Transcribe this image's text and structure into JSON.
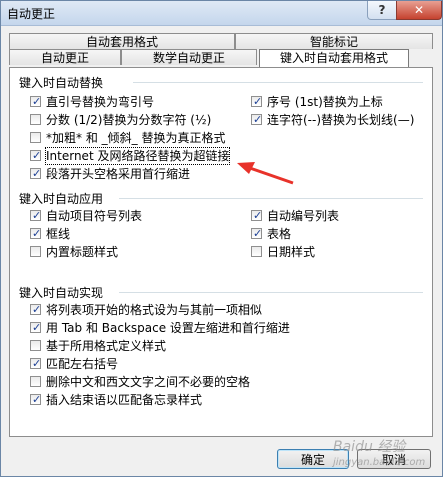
{
  "window": {
    "title": "自动更正",
    "help_label": "?",
    "close_label": "✕"
  },
  "tabs_back": [
    "自动套用格式",
    "智能标记"
  ],
  "tabs_front": [
    "自动更正",
    "数学自动更正",
    "键入时自动套用格式"
  ],
  "groups": {
    "replace": {
      "title": "键入时自动替换",
      "left": [
        {
          "label": "直引号替换为弯引号",
          "checked": true
        },
        {
          "label": "分数 (1/2)替换为分数字符 (½)",
          "checked": false
        },
        {
          "label": "*加粗* 和 _倾斜_ 替换为真正格式",
          "checked": false
        },
        {
          "label": "Internet 及网络路径替换为超链接",
          "checked": true
        },
        {
          "label": "段落开头空格采用首行缩进",
          "checked": true
        }
      ],
      "right": [
        {
          "label": "序号 (1st)替换为上标",
          "checked": true
        },
        {
          "label": "连字符(--)替换为长划线(—)",
          "checked": true
        }
      ]
    },
    "apply": {
      "title": "键入时自动应用",
      "left": [
        {
          "label": "自动项目符号列表",
          "checked": true
        },
        {
          "label": "框线",
          "checked": true
        },
        {
          "label": "内置标题样式",
          "checked": false
        }
      ],
      "right": [
        {
          "label": "自动编号列表",
          "checked": true
        },
        {
          "label": "表格",
          "checked": true
        },
        {
          "label": "日期样式",
          "checked": false
        }
      ]
    },
    "auto": {
      "title": "键入时自动实现",
      "items": [
        {
          "label": "将列表项开始的格式设为与其前一项相似",
          "checked": true
        },
        {
          "label": "用 Tab 和 Backspace 设置左缩进和首行缩进",
          "checked": true
        },
        {
          "label": "基于所用格式定义样式",
          "checked": false
        },
        {
          "label": "匹配左右括号",
          "checked": true
        },
        {
          "label": "删除中文和西文文字之间不必要的空格",
          "checked": false
        },
        {
          "label": "插入结束语以匹配备忘录样式",
          "checked": true
        }
      ]
    }
  },
  "buttons": {
    "ok": "确定",
    "cancel": "取消"
  },
  "watermark": {
    "line1": "Baidu 经验",
    "line2": "jingyan.baidu.com"
  },
  "colors": {
    "arrow": "#e8322a",
    "tick": "#1c3f94"
  }
}
